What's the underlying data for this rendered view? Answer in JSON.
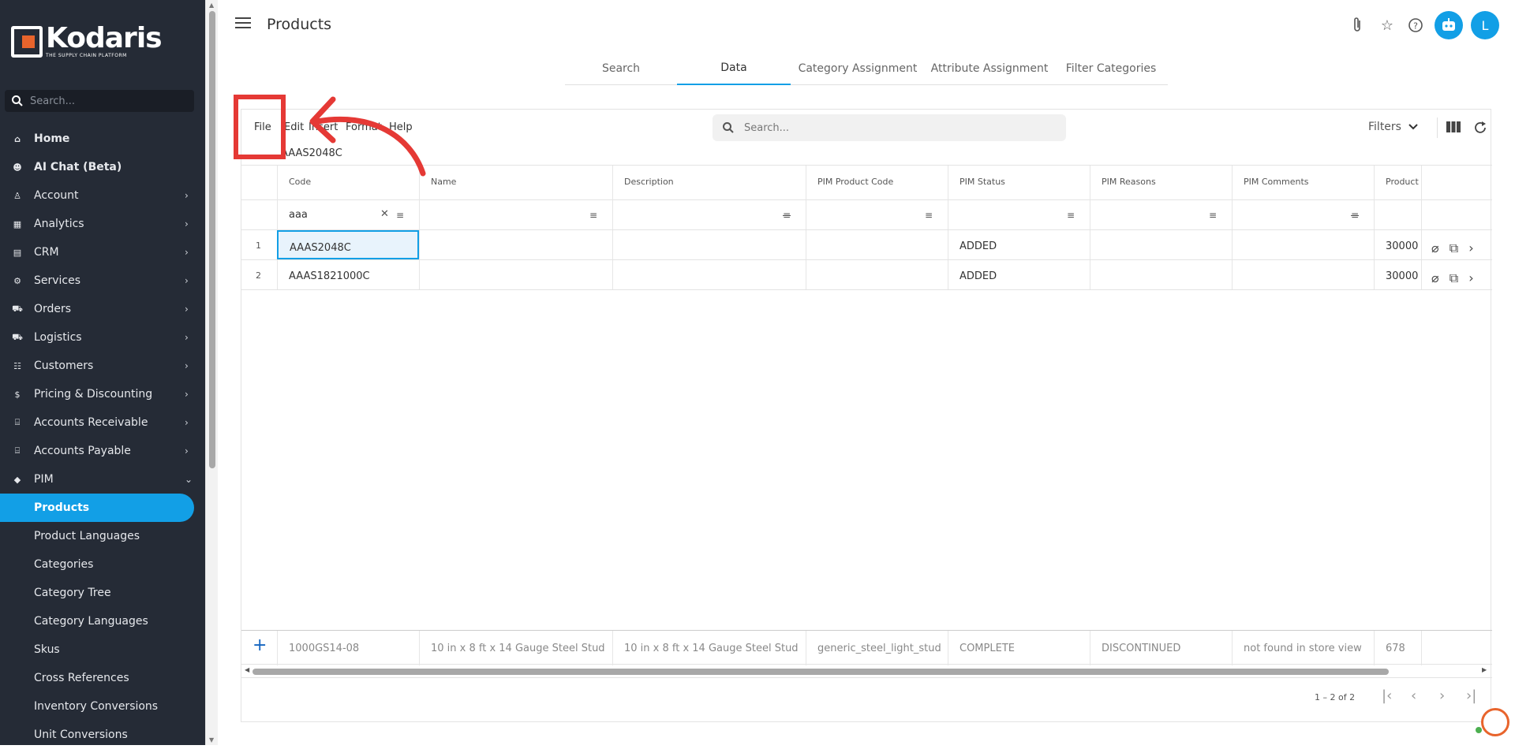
{
  "app": {
    "brand_name": "Kodaris",
    "brand_tagline": "THE SUPPLY CHAIN PLATFORM",
    "page_title": "Products",
    "avatar_letter": "L",
    "accent_color": "#129fe6"
  },
  "sidebar": {
    "search_placeholder": "Search...",
    "items": [
      {
        "label": "Home",
        "icon": "home-icon",
        "chevron": false
      },
      {
        "label": "AI Chat (Beta)",
        "icon": "robot-icon",
        "chevron": false
      },
      {
        "label": "Account",
        "icon": "person-icon",
        "chevron": true
      },
      {
        "label": "Analytics",
        "icon": "chart-icon",
        "chevron": true
      },
      {
        "label": "CRM",
        "icon": "contact-icon",
        "chevron": true
      },
      {
        "label": "Services",
        "icon": "gears-icon",
        "chevron": true
      },
      {
        "label": "Orders",
        "icon": "truck-icon",
        "chevron": true
      },
      {
        "label": "Logistics",
        "icon": "delivery-icon",
        "chevron": true
      },
      {
        "label": "Customers",
        "icon": "people-icon",
        "chevron": true
      },
      {
        "label": "Pricing & Discounting",
        "icon": "dollar-icon",
        "chevron": true
      },
      {
        "label": "Accounts Receivable",
        "icon": "bank-icon",
        "chevron": true
      },
      {
        "label": "Accounts Payable",
        "icon": "bank-icon",
        "chevron": true
      },
      {
        "label": "PIM",
        "icon": "tag-icon",
        "chevron": true
      }
    ],
    "pim_subitems": [
      "Products",
      "Product Languages",
      "Categories",
      "Category Tree",
      "Category Languages",
      "Skus",
      "Cross References",
      "Inventory Conversions",
      "Unit Conversions"
    ]
  },
  "tabs": [
    "Search",
    "Data",
    "Category Assignment",
    "Attribute Assignment",
    "Filter Categories"
  ],
  "toolbar": {
    "menus": [
      "File",
      "Edit",
      "Insert",
      "Format",
      "Help"
    ],
    "search_placeholder": "Search...",
    "filters_label": "Filters"
  },
  "cell_ref": "AAAS2048C",
  "grid": {
    "columns": [
      "Code",
      "Name",
      "Description",
      "PIM Product Code",
      "PIM Status",
      "PIM Reasons",
      "PIM Comments",
      "Product C"
    ],
    "code_filter_value": "aaa",
    "rows": [
      {
        "num": "1",
        "code": "AAAS2048C",
        "pim_status": "ADDED",
        "product": "30000"
      },
      {
        "num": "2",
        "code": "AAAS1821000C",
        "pim_status": "ADDED",
        "product": "30000"
      }
    ],
    "new_row": {
      "code": "1000GS14-08",
      "name": "10 in x 8 ft x 14 Gauge Steel Stud",
      "description": "10 in x 8 ft x 14 Gauge Steel Stud",
      "pim_product_code": "generic_steel_light_stud",
      "pim_status": "COMPLETE",
      "pim_reasons": "DISCONTINUED",
      "pim_comments": "not found in store view",
      "product": "678"
    }
  },
  "pagination": {
    "range": "1 – 2 of 2"
  }
}
